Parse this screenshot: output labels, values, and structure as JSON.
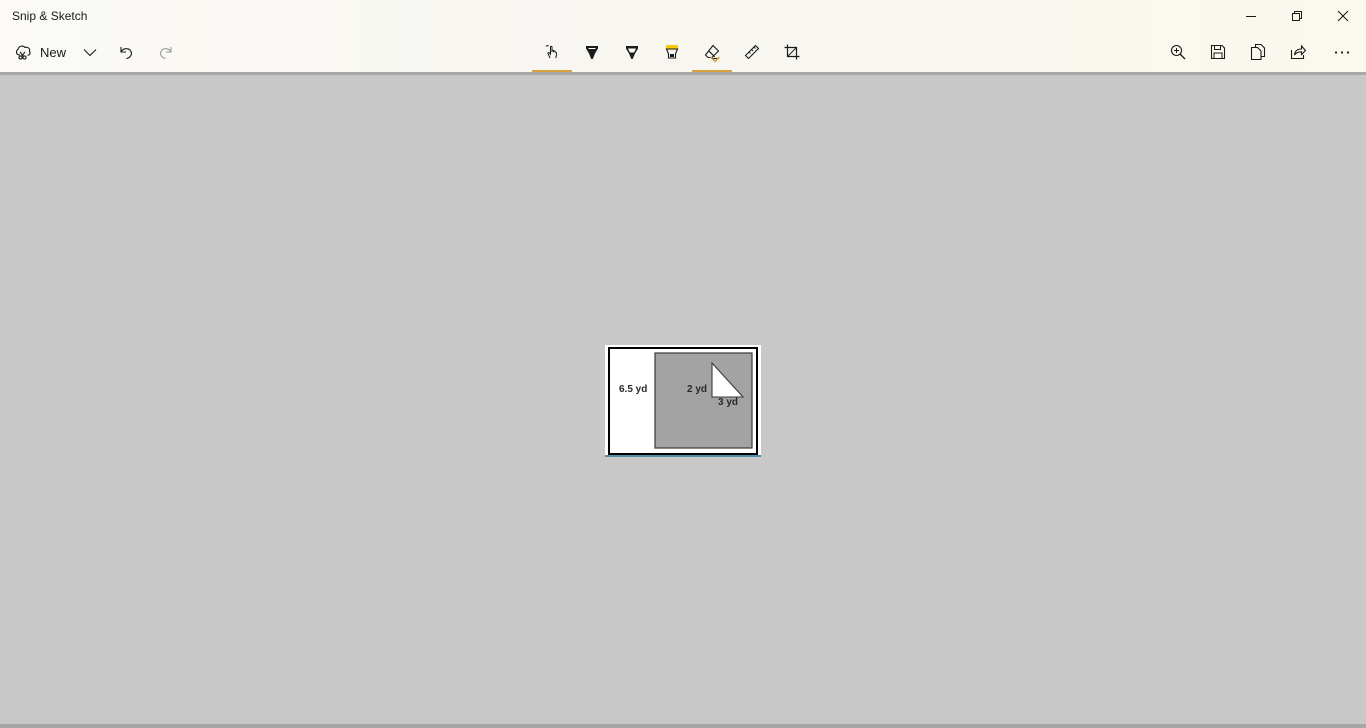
{
  "window": {
    "title": "Snip & Sketch"
  },
  "toolbar": {
    "new_label": "New",
    "icons": {
      "new": "snip-icon",
      "new_dropdown": "chevron-down-icon",
      "undo": "undo-icon",
      "redo": "redo-icon",
      "touch_writing": "touch-writing-icon",
      "ballpoint_pen": "ballpoint-pen-icon",
      "pencil": "pencil-icon",
      "highlighter": "highlighter-icon",
      "eraser": "eraser-icon",
      "ruler": "ruler-icon",
      "crop": "crop-icon",
      "zoom": "zoom-in-icon",
      "save": "save-icon",
      "copy": "copy-icon",
      "share": "share-icon",
      "more": "more-icon"
    },
    "colors": {
      "active_underline": "#d6a13c",
      "highlighter_yellow": "#f5d000"
    }
  },
  "canvas": {
    "background": "#c8c8c8",
    "image": {
      "labels": {
        "outer_side": "6.5 yd",
        "triangle_height": "2 yd",
        "triangle_base": "3 yd"
      },
      "colors": {
        "square_fill": "#a3a3a3",
        "triangle_fill": "#ffffff"
      }
    }
  }
}
